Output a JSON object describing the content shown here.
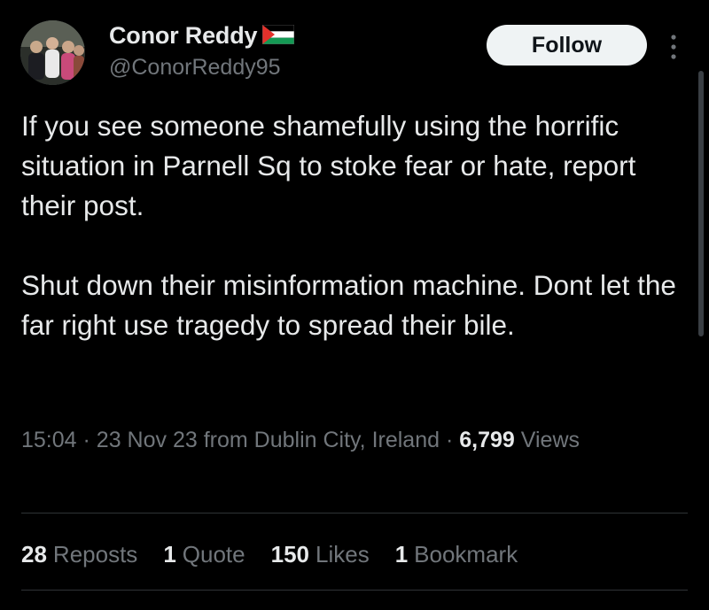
{
  "author": {
    "display_name": "Conor Reddy",
    "handle": "@ConorReddy95",
    "flag_icon": "palestine-flag-icon"
  },
  "follow_button_label": "Follow",
  "more_icon": "more-vertical-icon",
  "tweet": {
    "paragraph_1": "If you see someone shamefully using the horrific situation in Parnell Sq to stoke fear or hate, report their post.",
    "paragraph_2": "Shut down their misinformation machine. Dont let the far right use tragedy to spread their bile."
  },
  "meta": {
    "time": "15:04",
    "separator": "·",
    "date": "23 Nov 23",
    "location": "from Dublin City, Ireland",
    "views_count": "6,799",
    "views_label": "Views"
  },
  "stats": [
    {
      "count": "28",
      "label": "Reposts"
    },
    {
      "count": "1",
      "label": "Quote"
    },
    {
      "count": "150",
      "label": "Likes"
    },
    {
      "count": "1",
      "label": "Bookmark"
    }
  ],
  "colors": {
    "background": "#000000",
    "primary_text": "#e7e9ea",
    "secondary_text": "#71767b",
    "button_bg": "#eff3f4",
    "divider": "#2f3336"
  }
}
